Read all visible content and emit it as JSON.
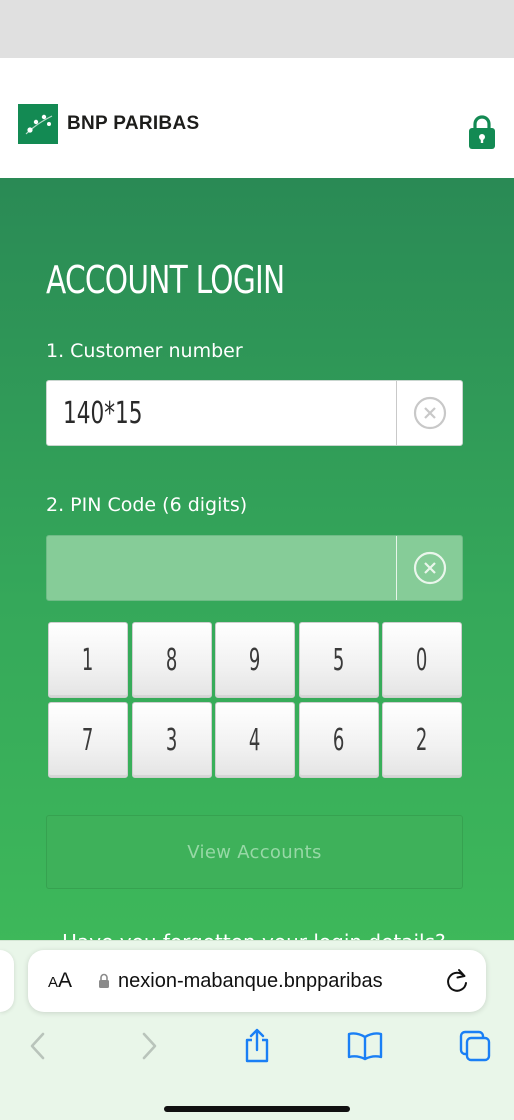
{
  "brand": {
    "name": "BNP PARIBAS"
  },
  "page": {
    "title": "ACCOUNT LOGIN",
    "customer_label": "1. Customer number",
    "customer_value": "140*15",
    "pin_label": "2. PIN Code (6 digits)",
    "pin_value": "",
    "view_button": "View Accounts",
    "cut_off_text": "Have you forgotten your login details?"
  },
  "keypad": {
    "keys": [
      "1",
      "8",
      "9",
      "5",
      "0",
      "7",
      "3",
      "4",
      "6",
      "2"
    ]
  },
  "browser": {
    "aa_small": "A",
    "aa_big": "A",
    "url": "nexion-mabanque.bnpparibas"
  },
  "icons": {
    "lock": "lock-icon",
    "clear": "clear-circle-x-icon",
    "back": "chevron-left-icon",
    "forward": "chevron-right-icon",
    "share": "share-icon",
    "bookmarks": "book-icon",
    "tabs": "tabs-icon",
    "reload": "reload-icon"
  },
  "colors": {
    "brand_green": "#138a53",
    "panel_top": "#2a8a55",
    "panel_bottom": "#42c05a",
    "ios_blue": "#1a7ff5"
  }
}
